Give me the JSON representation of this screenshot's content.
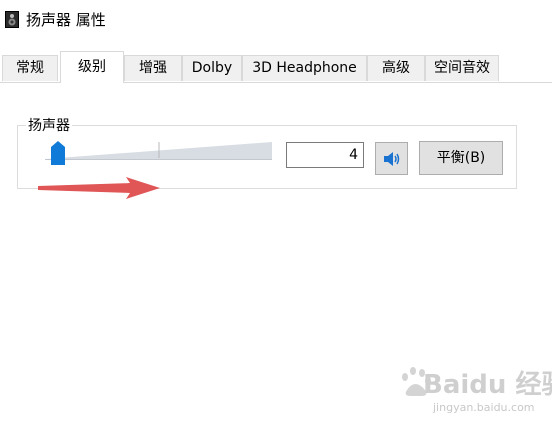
{
  "window": {
    "title": "扬声器 属性"
  },
  "tabs": [
    {
      "label": "常规",
      "active": false
    },
    {
      "label": "级别",
      "active": true
    },
    {
      "label": "增强",
      "active": false
    },
    {
      "label": "Dolby",
      "active": false
    },
    {
      "label": "3D Headphone",
      "active": false
    },
    {
      "label": "高级",
      "active": false
    },
    {
      "label": "空间音效",
      "active": false
    }
  ],
  "levels": {
    "group_label": "扬声器",
    "volume_value": "4",
    "volume_level_percent": 4,
    "mute_icon": "speaker-icon",
    "balance_label": "平衡(B)"
  },
  "annotation": {
    "arrow_color": "#e05555"
  },
  "watermark": {
    "brand": "Baidu 经验",
    "url": "jingyan.baidu.com"
  }
}
